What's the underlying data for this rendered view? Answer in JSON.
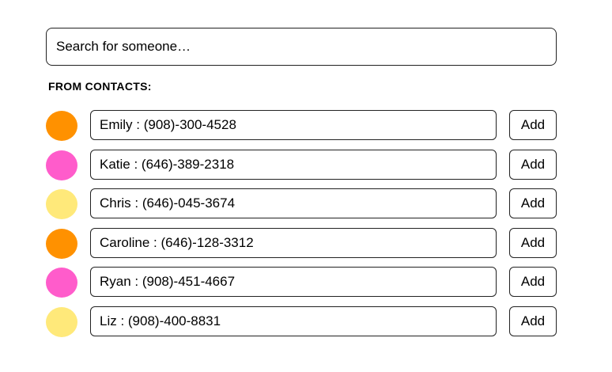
{
  "search": {
    "placeholder": "Search for someone…",
    "value": ""
  },
  "section_label": "FROM CONTACTS:",
  "contacts": [
    {
      "name": "Emily",
      "phone": "(908)-300-4528",
      "label": "Emily : (908)-300-4528",
      "color": "#FF9100",
      "add_label": "Add"
    },
    {
      "name": "Katie",
      "phone": "(646)-389-2318",
      "label": "Katie : (646)-389-2318",
      "color": "#FF5CCB",
      "add_label": "Add"
    },
    {
      "name": "Chris",
      "phone": "(646)-045-3674",
      "label": "Chris : (646)-045-3674",
      "color": "#FFE97A",
      "add_label": "Add"
    },
    {
      "name": "Caroline",
      "phone": "(646)-128-3312",
      "label": "Caroline : (646)-128-3312",
      "color": "#FF9100",
      "add_label": "Add"
    },
    {
      "name": "Ryan",
      "phone": "(908)-451-4667",
      "label": "Ryan : (908)-451-4667",
      "color": "#FF5CCB",
      "add_label": "Add"
    },
    {
      "name": "Liz",
      "phone": "(908)-400-8831",
      "label": "Liz : (908)-400-8831",
      "color": "#FFE97A",
      "add_label": "Add"
    }
  ]
}
